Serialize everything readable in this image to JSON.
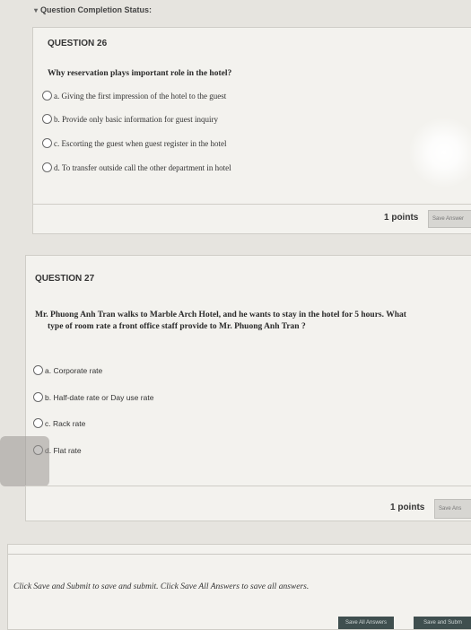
{
  "header": {
    "status_label": "Question Completion Status:"
  },
  "q26": {
    "heading": "QUESTION 26",
    "text": "Why reservation plays important role in the hotel?",
    "options": [
      "a. Giving the first impression of the hotel to the guest",
      "b. Provide only basic information for guest inquiry",
      "c. Escorting the guest when guest register in the hotel",
      "d. To transfer outside call the other department in hotel"
    ],
    "points": "1 points",
    "save_label": "Save Answer"
  },
  "q27": {
    "heading": "QUESTION 27",
    "text_line1": "Mr. Phuong Anh Tran walks to Marble Arch Hotel, and he wants to stay in the hotel for 5 hours. What",
    "text_line2": "type of room rate a front office staff provide to Mr. Phuong Anh Tran ?",
    "options": [
      "a. Corporate rate",
      "b. Half-date rate or Day use rate",
      "c. Rack rate",
      "d. Flat rate"
    ],
    "points": "1 points",
    "save_label": "Save Ans"
  },
  "footer": {
    "instructions": "Click Save and Submit to save and submit. Click Save All Answers to save all answers.",
    "save_all_label": "Save All Answers",
    "save_submit_label": "Save and Subm"
  }
}
